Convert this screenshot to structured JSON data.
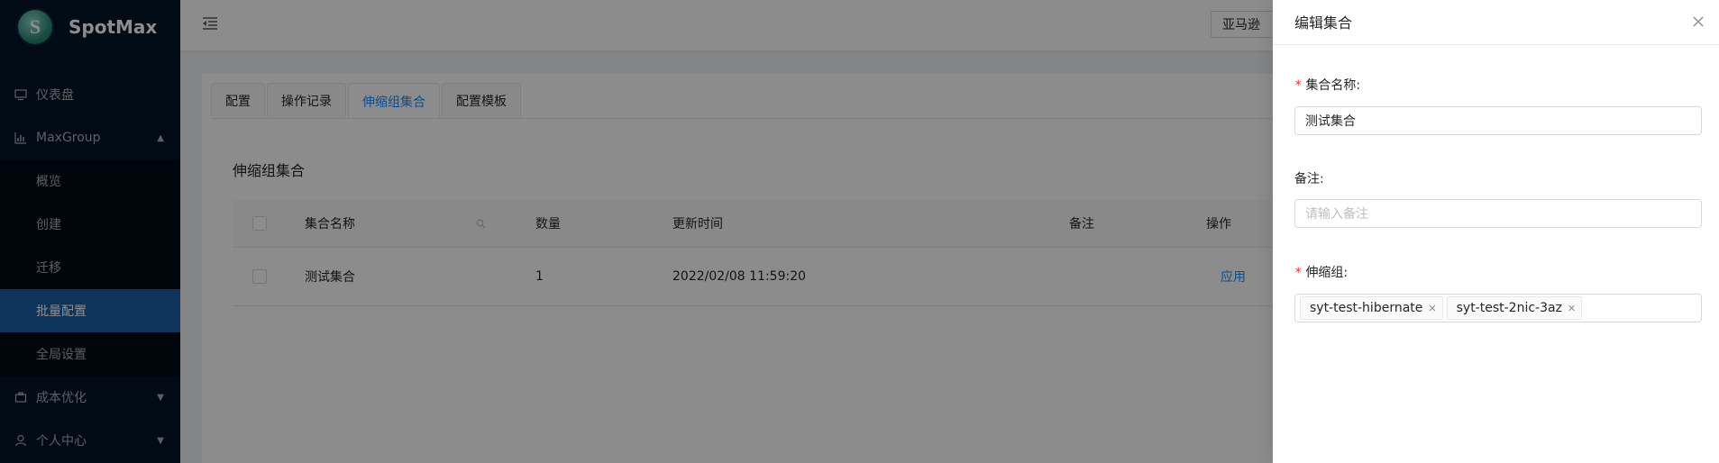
{
  "brand": {
    "name": "SpotMax",
    "logo_letter": "S"
  },
  "sidebar": {
    "items": [
      {
        "label": "仪表盘",
        "icon": "monitor-icon"
      },
      {
        "label": "MaxGroup",
        "icon": "chart-icon",
        "expanded": true
      },
      {
        "label": "概览"
      },
      {
        "label": "创建"
      },
      {
        "label": "迁移"
      },
      {
        "label": "批量配置",
        "active": true
      },
      {
        "label": "全局设置"
      },
      {
        "label": "成本优化",
        "icon": "briefcase-icon"
      },
      {
        "label": "个人中心",
        "icon": "user-icon"
      }
    ]
  },
  "header": {
    "region": "亚马逊"
  },
  "tabs": [
    "配置",
    "操作记录",
    "伸缩组集合",
    "配置模板"
  ],
  "active_tab": "伸缩组集合",
  "card_title": "伸缩组集合",
  "table": {
    "columns": [
      "集合名称",
      "数量",
      "更新时间",
      "备注",
      "操作"
    ],
    "rows": [
      {
        "name": "测试集合",
        "count": "1",
        "updated": "2022/02/08 11:59:20",
        "remark": "",
        "action": "应用"
      }
    ]
  },
  "drawer": {
    "title": "编辑集合",
    "name_label": "集合名称:",
    "name_value": "测试集合",
    "remark_label": "备注:",
    "remark_placeholder": "请输入备注",
    "groups_label": "伸缩组:",
    "groups": [
      "syt-test-hibernate",
      "syt-test-2nic-3az"
    ]
  },
  "colors": {
    "sidebar_bg": "#001529",
    "primary": "#1890ff",
    "active_menu": "#1d5fa8",
    "required": "#f5222d"
  }
}
